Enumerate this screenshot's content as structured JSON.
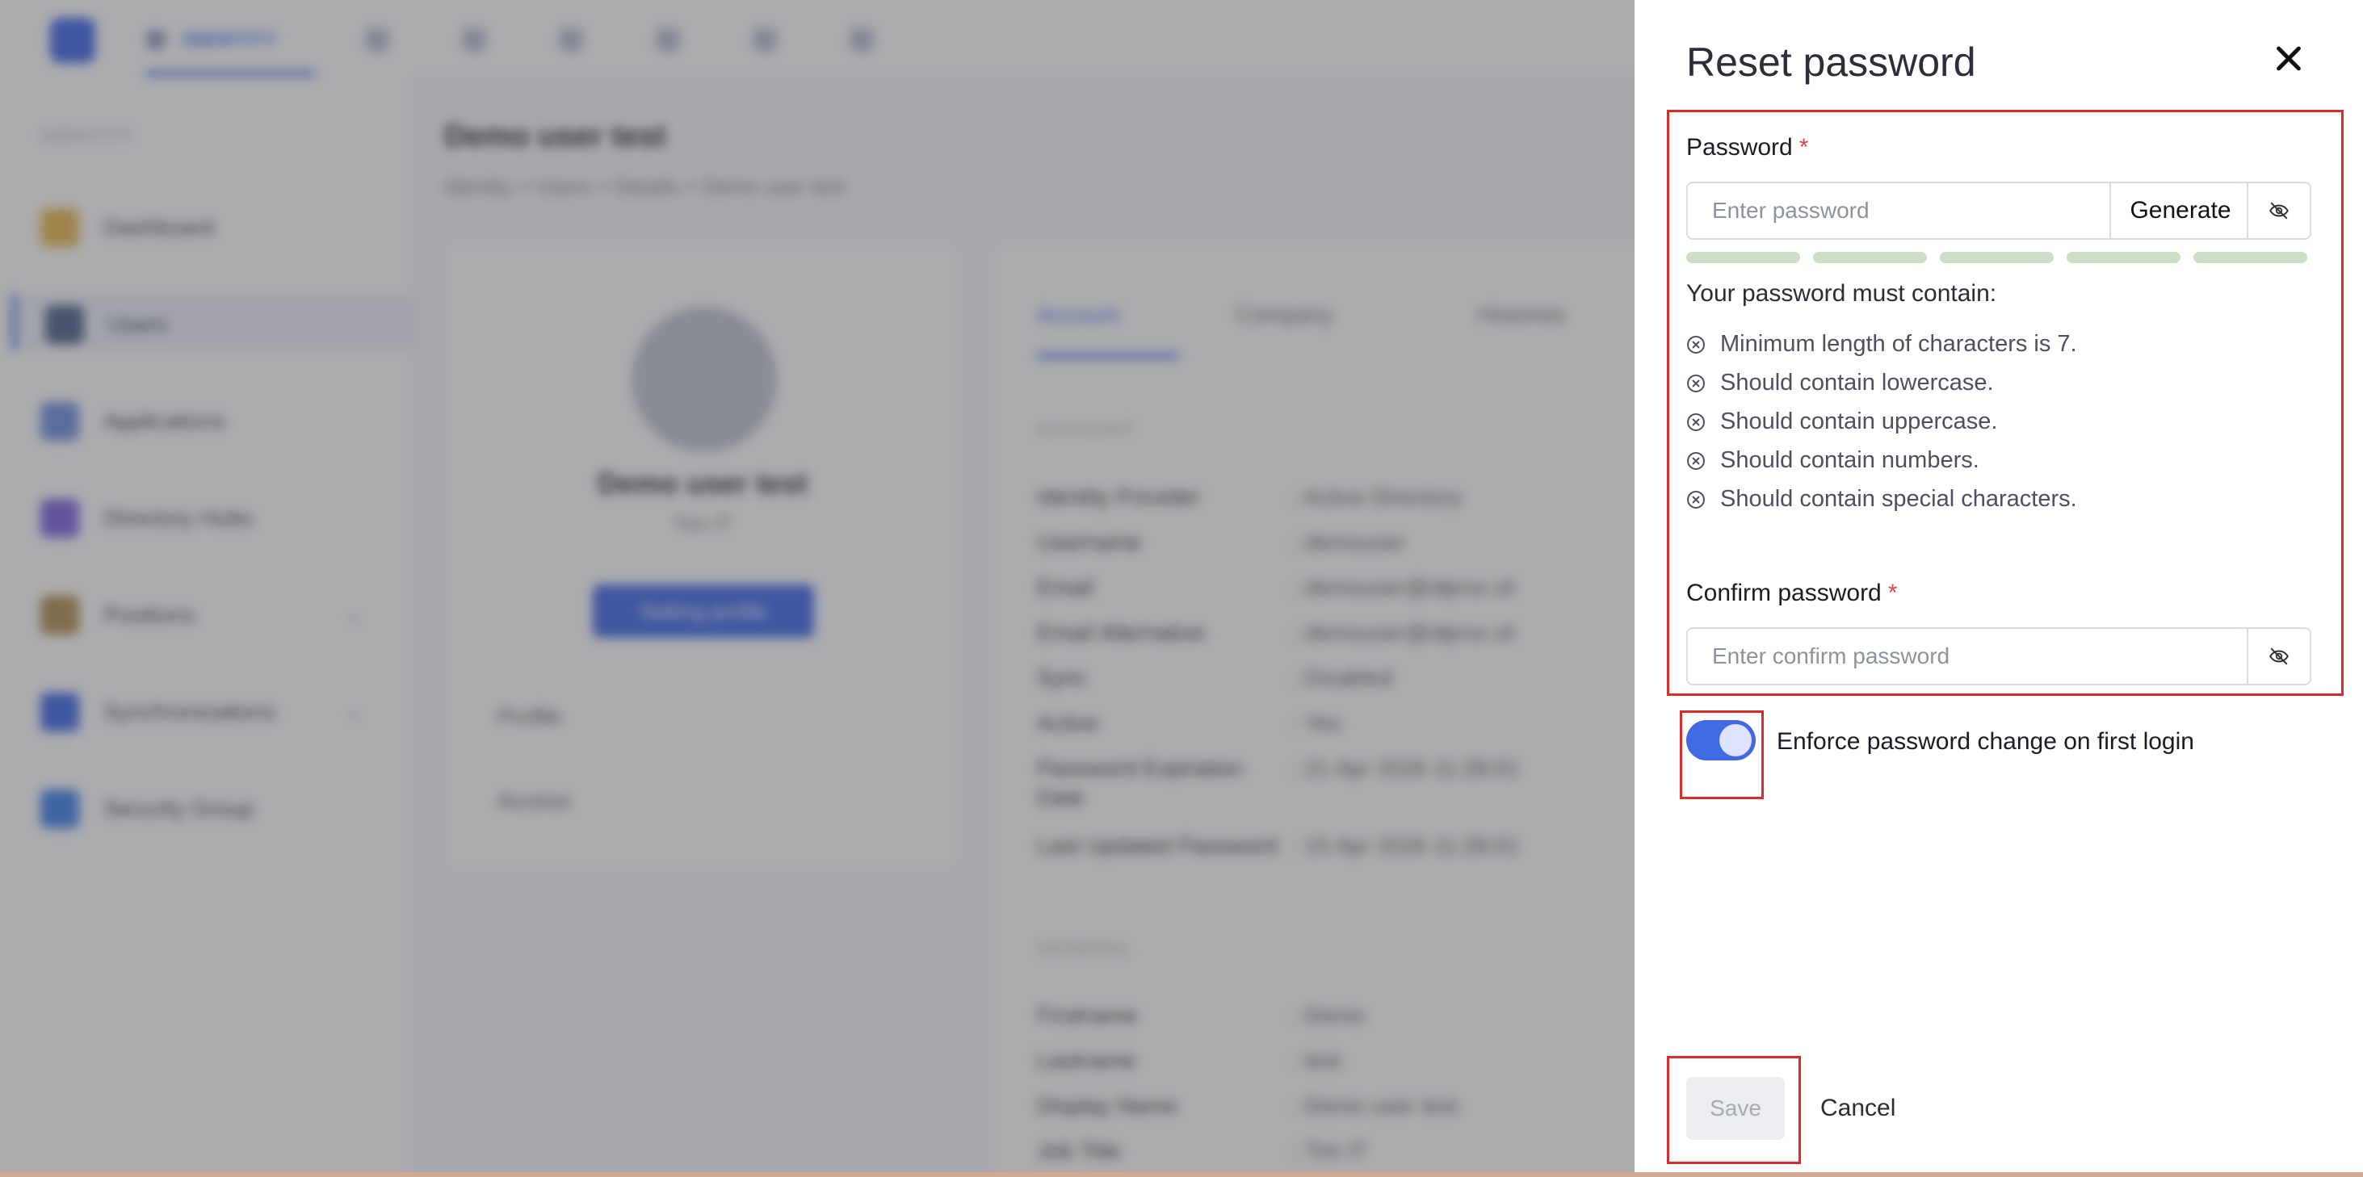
{
  "background": {
    "topnav": {
      "active_tab": "IDENTITY"
    },
    "sidebar": {
      "heading": "IDENTITY",
      "items": [
        {
          "label": "Dashboard"
        },
        {
          "label": "Users"
        },
        {
          "label": "Applications"
        },
        {
          "label": "Directory Hubs"
        },
        {
          "label": "Positions"
        },
        {
          "label": "Synchronizations"
        },
        {
          "label": "Security Group"
        }
      ]
    },
    "page": {
      "title": "Demo user test",
      "breadcrumb": "Identity  >  Users  >  Details  >  Demo user test"
    },
    "profile_card": {
      "name": "Demo user test",
      "role": "Tim IT",
      "edit_button": "Setting profile",
      "links": [
        "Profile",
        "Access"
      ]
    },
    "detail_card": {
      "tabs": [
        "Account",
        "Company",
        "Histories"
      ],
      "section_account": "ACCOUNT",
      "rows": [
        {
          "key": "Identity Provider",
          "value": ": Active Directory"
        },
        {
          "key": "Username",
          "value": ": demouser"
        },
        {
          "key": "Email",
          "value": ": demouser@idproc.id"
        },
        {
          "key": "Email Alternative",
          "value": ": demouser@idproc.id"
        },
        {
          "key": "Sync",
          "value": ": Disabled"
        },
        {
          "key": "Active",
          "value": ": Yes"
        },
        {
          "key": "Password Expiration Date",
          "value": ": 21 Apr 2026 11:28:01"
        },
        {
          "key": "Last Updated Password",
          "value": ": 15 Apr 2026 11:28:01"
        }
      ],
      "section_general": "GENERAL",
      "rows2": [
        {
          "key": "Firstname",
          "value": ": Demo"
        },
        {
          "key": "Lastname",
          "value": ": test"
        },
        {
          "key": "Display Name",
          "value": ": Demo user test"
        },
        {
          "key": "Job Title",
          "value": ": Tim IT"
        }
      ]
    }
  },
  "drawer": {
    "title": "Reset password",
    "password": {
      "label": "Password",
      "required_mark": "*",
      "placeholder": "Enter password",
      "value": "",
      "generate_label": "Generate",
      "strength_segments": 5
    },
    "requirements": {
      "heading": "Your password must contain:",
      "items": [
        "Minimum length of characters is 7.",
        "Should contain lowercase.",
        "Should contain uppercase.",
        "Should contain numbers.",
        "Should contain special characters."
      ]
    },
    "confirm": {
      "label": "Confirm password",
      "required_mark": "*",
      "placeholder": "Enter confirm password",
      "value": ""
    },
    "enforce_toggle": {
      "label": "Enforce password change on first login",
      "checked": true
    },
    "actions": {
      "save_label": "Save",
      "cancel_label": "Cancel"
    }
  },
  "colors": {
    "accent": "#4169e1",
    "highlight": "#d92d2d",
    "strength_segment": "#cde0c7",
    "required": "#e04646"
  }
}
